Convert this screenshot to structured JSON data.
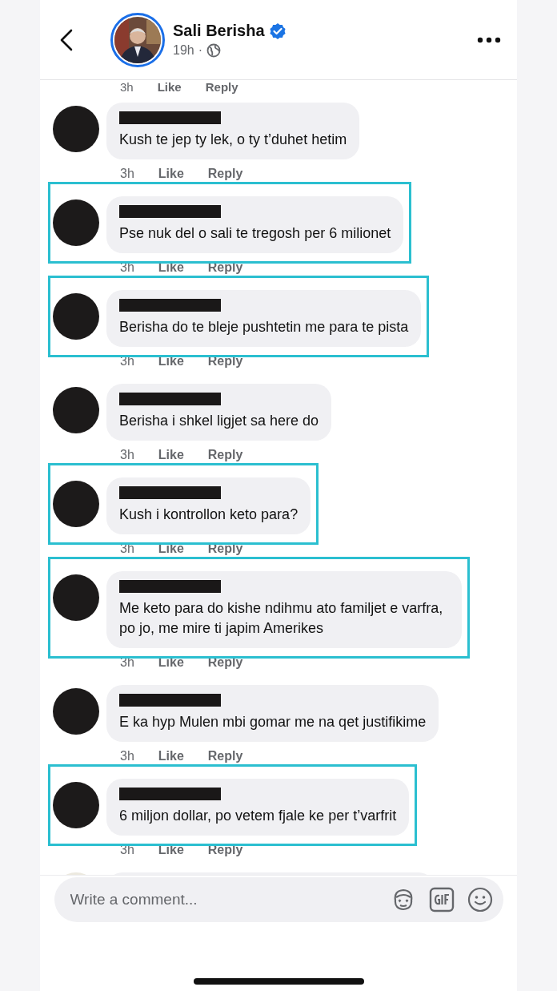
{
  "header": {
    "name": "Sali Berisha",
    "verified": true,
    "time": "19h",
    "separator": "·"
  },
  "top_actions": {
    "time": "3h",
    "like": "Like",
    "reply": "Reply"
  },
  "comments": [
    {
      "text": "Kush te jep ty lek, o ty t’duhet hetim",
      "time": "3h",
      "like": "Like",
      "reply": "Reply",
      "highlighted": false
    },
    {
      "text": "Pse nuk del o sali te tregosh per 6 milionet",
      "time": "3h",
      "like": "Like",
      "reply": "Reply",
      "highlighted": true
    },
    {
      "text": "Berisha do te bleje pushtetin me para te pista",
      "time": "3h",
      "like": "Like",
      "reply": "Reply",
      "highlighted": true
    },
    {
      "text": "Berisha i shkel ligjet sa here do",
      "time": "3h",
      "like": "Like",
      "reply": "Reply",
      "highlighted": false
    },
    {
      "text": "Kush i kontrollon keto para?",
      "time": "3h",
      "like": "Like",
      "reply": "Reply",
      "highlighted": true
    },
    {
      "text": "Me keto para do kishe ndihmu ato familjet e varfra, po jo, me mire ti japim Amerikes",
      "time": "3h",
      "like": "Like",
      "reply": "Reply",
      "highlighted": true
    },
    {
      "text": "E ka hyp Mulen mbi gomar me na qet justifikime",
      "time": "3h",
      "like": "Like",
      "reply": "Reply",
      "highlighted": false
    },
    {
      "text": "6 miljon dollar, po vetem fjale ke per t’varfrit",
      "time": "3h",
      "like": "Like",
      "reply": "Reply",
      "highlighted": true
    }
  ],
  "composer": {
    "placeholder": "Write a comment..."
  }
}
